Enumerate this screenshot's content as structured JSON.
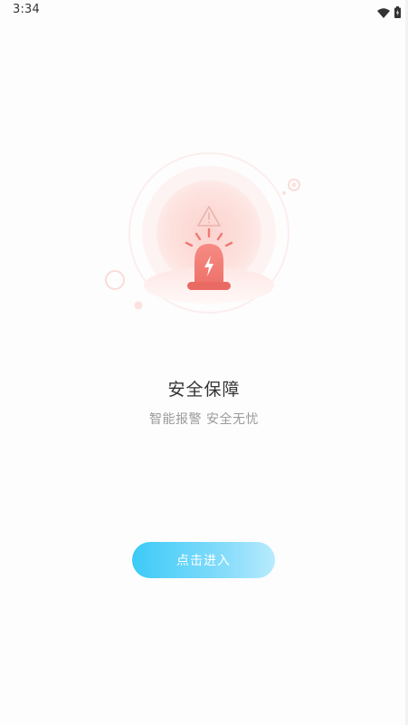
{
  "status_bar": {
    "time": "3:34",
    "icons": [
      "wifi-icon",
      "battery-charging-icon"
    ]
  },
  "hero": {
    "icon": "alarm-siren-icon"
  },
  "main": {
    "title": "安全保障",
    "subtitle": "智能报警 安全无忧"
  },
  "actions": {
    "enter_label": "点击进入"
  },
  "colors": {
    "siren": "#f07f78",
    "siren_dark": "#e96a63",
    "glow": "#fde2df",
    "button_start": "#3ccaf7",
    "button_end": "#b8ebfd",
    "title": "#333333",
    "subtitle": "#9a9a9a"
  }
}
